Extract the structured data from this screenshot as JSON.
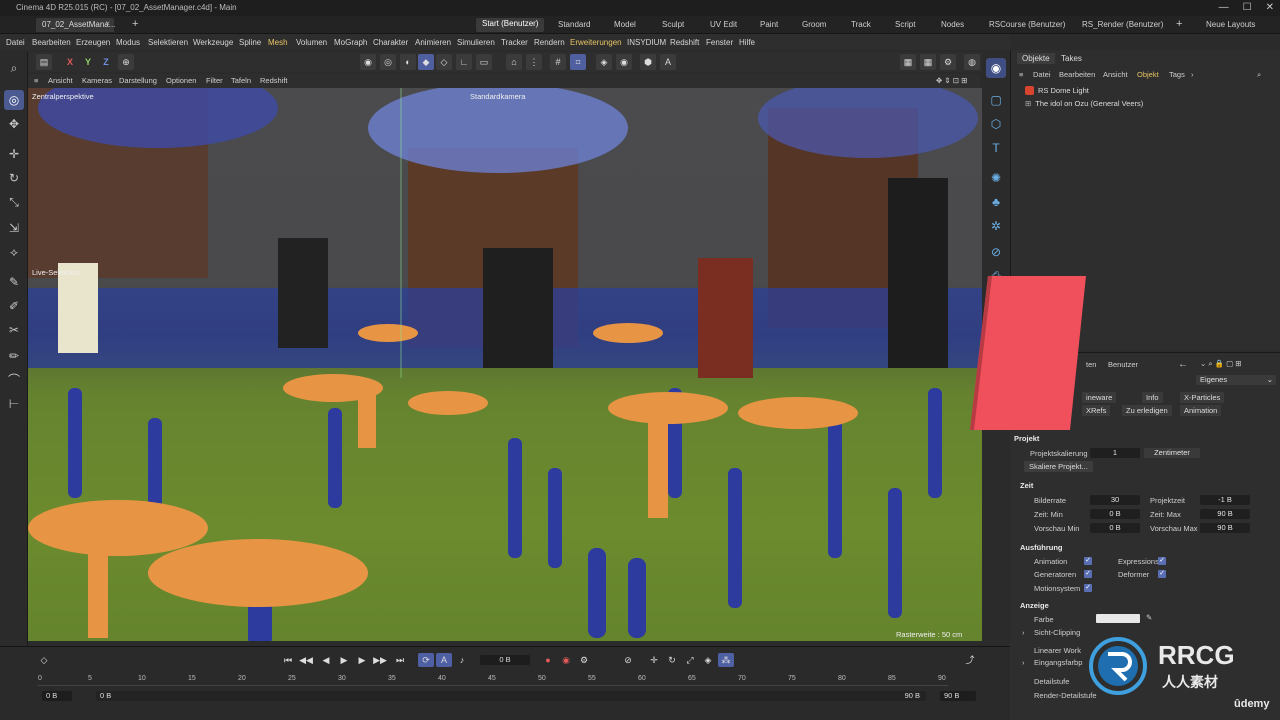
{
  "title_bar": {
    "text": "Cinema 4D R25.015 (RC) - [07_02_AssetManager.c4d] - Main"
  },
  "doc_tab": {
    "label": "07_02_AssetMana..."
  },
  "layouts": [
    "Start (Benutzer)",
    "Standard",
    "Model",
    "Sculpt",
    "UV Edit",
    "Paint",
    "Groom",
    "Track",
    "Script",
    "Nodes",
    "RSCourse (Benutzer)",
    "RS_Render (Benutzer)"
  ],
  "new_layouts": "Neue Layouts",
  "menu": [
    "Datei",
    "Bearbeiten",
    "Erzeugen",
    "Modus",
    "Selektieren",
    "Werkzeuge",
    "Spline",
    "Mesh",
    "Volumen",
    "MoGraph",
    "Charakter",
    "Animieren",
    "Simulieren",
    "Tracker",
    "Rendern",
    "Erweiterungen",
    "INSYDIUM",
    "Redshift",
    "Fenster",
    "Hilfe"
  ],
  "axis_buttons": {
    "x": "X",
    "y": "Y",
    "z": "Z"
  },
  "viewport_menu": [
    "Ansicht",
    "Kameras",
    "Darstellung",
    "Optionen",
    "Filter",
    "Tafeln",
    "Redshift"
  ],
  "viewport": {
    "perspective_label": "Zentralperspektive",
    "camera_label": "Standardkamera",
    "live_selection_label": "Live-Selektion",
    "grid_spacing": "Rasterweite : 50 cm"
  },
  "objects_panel": {
    "tabs": [
      "Objekte",
      "Takes"
    ],
    "menu": [
      "Datei",
      "Bearbeiten",
      "Ansicht",
      "Objekt",
      "Tags"
    ],
    "items": [
      {
        "name": "RS Dome Light",
        "color": "#d9442e"
      },
      {
        "name": "The idol on Ozu (General Veers)",
        "color": "#888888"
      }
    ]
  },
  "attributes_panel": {
    "header_fragment": "ten",
    "header_user": "Benutzer",
    "mode_dropdown": "Eigenes",
    "chips_row1": [
      "ineware",
      "Info",
      "X-Particles"
    ],
    "chips_row2": [
      "XRefs",
      "Zu erledigen",
      "Animation"
    ],
    "project_section": "Projekt",
    "project_scale_label": "Projektskalierung",
    "project_scale_value": "1",
    "project_scale_unit": "Zentimeter",
    "scale_button": "Skaliere Projekt...",
    "time_section": "Zeit",
    "fps_label": "Bilderrate",
    "fps_value": "30",
    "project_time_label": "Projektzeit",
    "project_time_value": "-1 B",
    "min_time_label": "Zeit: Min",
    "min_time_value": "0 B",
    "max_time_label": "Zeit: Max",
    "max_time_value": "90 B",
    "preview_min_label": "Vorschau Min",
    "preview_min_value": "0 B",
    "preview_max_label": "Vorschau Max",
    "preview_max_value": "90 B",
    "execution_section": "Ausführung",
    "animation_label": "Animation",
    "expressions_label": "Expressions",
    "generators_label": "Generatoren",
    "deformers_label": "Deformer",
    "motion_label": "Motionsystem",
    "display_section": "Anzeige",
    "color_label": "Farbe",
    "view_clip_label": "Sicht-Clipping",
    "linear_label": "Linearer Work",
    "input_label": "Eingangsfarbp",
    "detail_label": "Detailstufe",
    "render_detail_label": "Render-Detailstufe"
  },
  "timeline": {
    "current_frame": "0 B",
    "ruler": [
      "0",
      "5",
      "10",
      "15",
      "20",
      "25",
      "30",
      "35",
      "40",
      "45",
      "50",
      "55",
      "60",
      "65",
      "70",
      "75",
      "80",
      "85",
      "90"
    ],
    "start_field": "0 B",
    "start_field2": "0 B",
    "end_field": "90 B",
    "end_field2": "90 B"
  },
  "watermark": {
    "brand": "RRCG",
    "subtitle": "人人素材",
    "udemy": "ûdemy"
  }
}
